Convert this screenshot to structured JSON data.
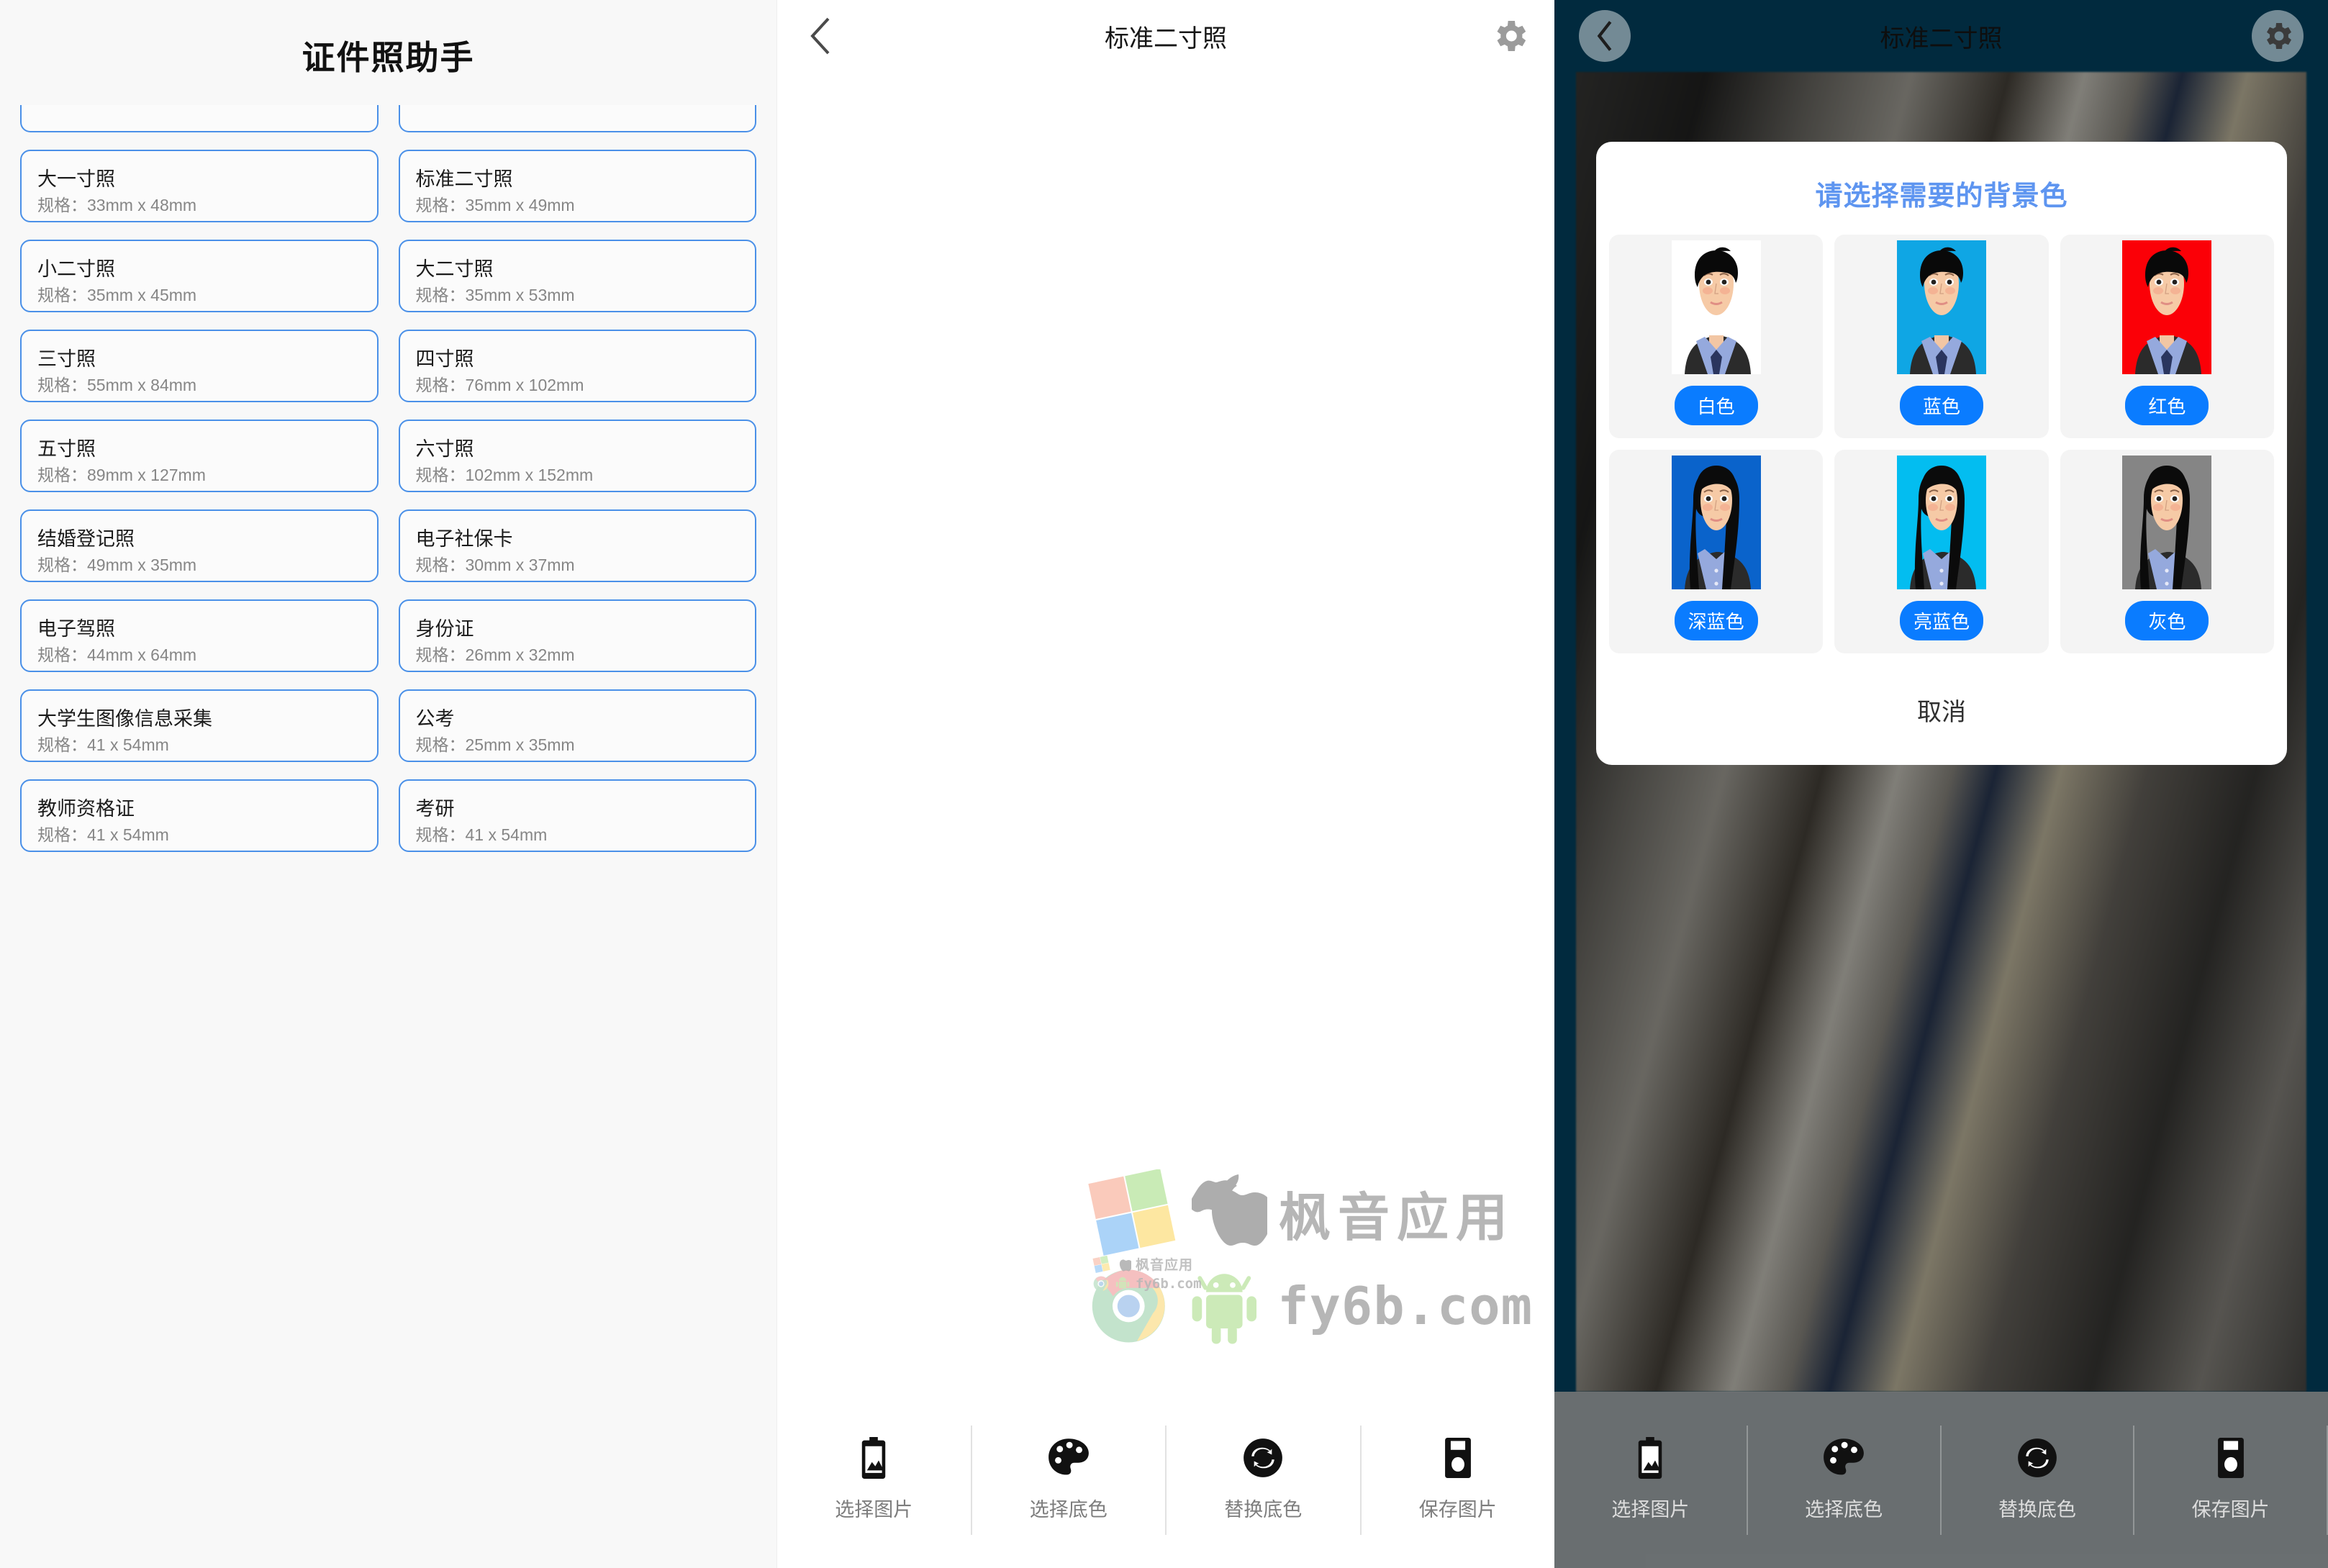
{
  "panel1": {
    "app_title": "证件照助手",
    "spec_label_prefix": "规格：",
    "clipped_cards": [
      {
        "name": "",
        "size": ""
      },
      {
        "name": "",
        "size": ""
      }
    ],
    "cards": [
      {
        "name": "大一寸照",
        "size": "规格：33mm x 48mm"
      },
      {
        "name": "标准二寸照",
        "size": "规格：35mm x 49mm"
      },
      {
        "name": "小二寸照",
        "size": "规格：35mm x 45mm"
      },
      {
        "name": "大二寸照",
        "size": "规格：35mm x 53mm"
      },
      {
        "name": "三寸照",
        "size": "规格：55mm x 84mm"
      },
      {
        "name": "四寸照",
        "size": "规格：76mm x 102mm"
      },
      {
        "name": "五寸照",
        "size": "规格：89mm x 127mm"
      },
      {
        "name": "六寸照",
        "size": "规格：102mm x 152mm"
      },
      {
        "name": "结婚登记照",
        "size": "规格：49mm x 35mm"
      },
      {
        "name": "电子社保卡",
        "size": "规格：30mm x 37mm"
      },
      {
        "name": "电子驾照",
        "size": "规格：44mm x 64mm"
      },
      {
        "name": "身份证",
        "size": "规格：26mm x 32mm"
      },
      {
        "name": "大学生图像信息采集",
        "size": "规格：41 x 54mm"
      },
      {
        "name": "公考",
        "size": "规格：25mm x 35mm"
      },
      {
        "name": "教师资格证",
        "size": "规格：41 x 54mm"
      },
      {
        "name": "考研",
        "size": "规格：41 x 54mm"
      }
    ]
  },
  "panel2": {
    "topbar": {
      "back_icon": "chevron-left-icon",
      "title": "标准二寸照",
      "settings_icon": "gear-icon"
    },
    "watermark": {
      "brand_cn": "枫音应用",
      "brand_url": "fy6b.com",
      "small_cn": "枫音应用",
      "small_url": "fy6b.com"
    },
    "toolbar": [
      {
        "icon": "image-picker-icon",
        "label": "选择图片"
      },
      {
        "icon": "palette-icon",
        "label": "选择底色"
      },
      {
        "icon": "swap-circle-icon",
        "label": "替换底色"
      },
      {
        "icon": "save-icon",
        "label": "保存图片"
      }
    ]
  },
  "panel3": {
    "topbar": {
      "back_icon": "chevron-left-icon",
      "title": "标准二寸照",
      "settings_icon": "gear-icon"
    },
    "dialog": {
      "title": "请选择需要的背景色",
      "cancel_label": "取消",
      "accent": "#0a7cff",
      "title_color": "#5e95f0",
      "options": [
        {
          "label": "白色",
          "bg": "#ffffff",
          "person": "male"
        },
        {
          "label": "蓝色",
          "bg": "#0fa6e4",
          "person": "male"
        },
        {
          "label": "红色",
          "bg": "#fb0007",
          "person": "male"
        },
        {
          "label": "深蓝色",
          "bg": "#0a63cb",
          "person": "female"
        },
        {
          "label": "亮蓝色",
          "bg": "#03bdf0",
          "person": "female"
        },
        {
          "label": "灰色",
          "bg": "#858585",
          "person": "female"
        }
      ]
    },
    "background_color": "#024565",
    "toolbar": [
      {
        "icon": "image-picker-icon",
        "label": "选择图片"
      },
      {
        "icon": "palette-icon",
        "label": "选择底色"
      },
      {
        "icon": "swap-circle-icon",
        "label": "替换底色"
      },
      {
        "icon": "save-icon",
        "label": "保存图片"
      }
    ]
  }
}
